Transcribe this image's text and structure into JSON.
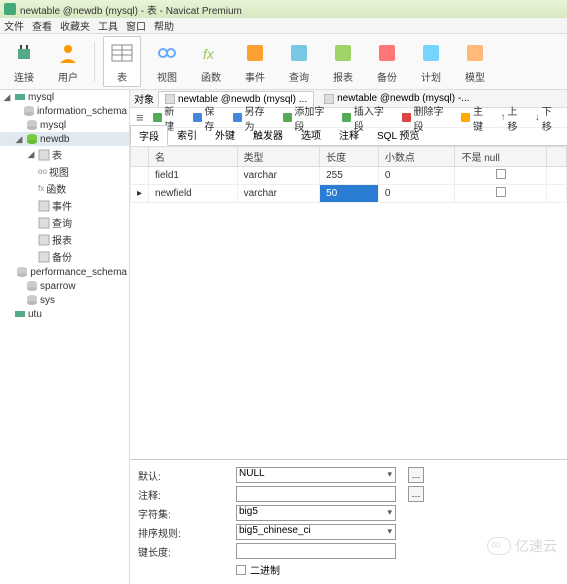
{
  "titlebar": {
    "text": "newtable @newdb (mysql) - 表 - Navicat Premium"
  },
  "menubar": {
    "items": [
      "文件",
      "查看",
      "收藏夹",
      "工具",
      "窗口",
      "帮助"
    ]
  },
  "ribbon": {
    "items": [
      {
        "label": "连接",
        "icon": "plug"
      },
      {
        "label": "用户",
        "icon": "user"
      },
      {
        "label": "表",
        "icon": "table",
        "active": true
      },
      {
        "label": "视图",
        "icon": "view"
      },
      {
        "label": "函数",
        "icon": "fx"
      },
      {
        "label": "事件",
        "icon": "clock"
      },
      {
        "label": "查询",
        "icon": "search"
      },
      {
        "label": "报表",
        "icon": "report"
      },
      {
        "label": "备份",
        "icon": "backup"
      },
      {
        "label": "计划",
        "icon": "schedule"
      },
      {
        "label": "模型",
        "icon": "model"
      }
    ]
  },
  "sidebar": {
    "items": [
      {
        "label": "mysql",
        "icon": "db-conn",
        "depth": 0,
        "expanded": true
      },
      {
        "label": "information_schema",
        "icon": "db",
        "depth": 1
      },
      {
        "label": "mysql",
        "icon": "db",
        "depth": 1
      },
      {
        "label": "newdb",
        "icon": "db-open",
        "depth": 1,
        "expanded": true,
        "selected": true
      },
      {
        "label": "表",
        "icon": "table",
        "depth": 2,
        "expanded": true
      },
      {
        "label": "视图",
        "icon": "view",
        "depth": 2,
        "prefix": "oo"
      },
      {
        "label": "函数",
        "icon": "fx",
        "depth": 2,
        "prefix": "fx"
      },
      {
        "label": "事件",
        "icon": "clock",
        "depth": 2
      },
      {
        "label": "查询",
        "icon": "search",
        "depth": 2
      },
      {
        "label": "报表",
        "icon": "report",
        "depth": 2
      },
      {
        "label": "备份",
        "icon": "backup",
        "depth": 2
      },
      {
        "label": "performance_schema",
        "icon": "db",
        "depth": 1
      },
      {
        "label": "sparrow",
        "icon": "db",
        "depth": 1
      },
      {
        "label": "sys",
        "icon": "db",
        "depth": 1
      },
      {
        "label": "utu",
        "icon": "db-conn",
        "depth": 0
      }
    ]
  },
  "tabbar": {
    "obj_label": "对象",
    "tabs": [
      {
        "label": "newtable @newdb (mysql) ...",
        "active": true
      },
      {
        "label": "newtable @newdb (mysql) -..."
      }
    ]
  },
  "sub_toolbar": {
    "hamburger": "≡",
    "items": [
      {
        "label": "新建",
        "icon": "new"
      },
      {
        "label": "保存",
        "icon": "save"
      },
      {
        "label": "另存为",
        "icon": "saveas"
      },
      {
        "label": "添加字段",
        "icon": "addfield"
      },
      {
        "label": "插入字段",
        "icon": "insertfield"
      },
      {
        "label": "删除字段",
        "icon": "delfield"
      },
      {
        "label": "主键",
        "icon": "pk"
      },
      {
        "label": "上移",
        "icon": "up",
        "arrow": "↑"
      },
      {
        "label": "下移",
        "icon": "down",
        "arrow": "↓"
      }
    ]
  },
  "sub_tabs": {
    "items": [
      "字段",
      "索引",
      "外键",
      "触发器",
      "选项",
      "注释",
      "SQL 预览"
    ],
    "active": 0
  },
  "grid": {
    "headers": [
      "名",
      "类型",
      "长度",
      "小数点",
      "不是 null"
    ],
    "rows": [
      {
        "name": "field1",
        "type": "varchar",
        "length": "255",
        "decimals": "0",
        "notnull": false,
        "selected": false
      },
      {
        "name": "newfield",
        "type": "varchar",
        "length": "50",
        "decimals": "0",
        "notnull": false,
        "selected": true,
        "indicator": "▸"
      }
    ]
  },
  "props": {
    "rows": [
      {
        "label": "默认:",
        "type": "select",
        "value": "NULL",
        "extra_btn": true
      },
      {
        "label": "注释:",
        "type": "input",
        "value": "",
        "extra_btn": true
      },
      {
        "label": "字符集:",
        "type": "select",
        "value": "big5"
      },
      {
        "label": "排序规则:",
        "type": "select",
        "value": "big5_chinese_ci"
      },
      {
        "label": "键长度:",
        "type": "input",
        "value": ""
      },
      {
        "label": "",
        "type": "checkbox",
        "check_label": "二进制"
      }
    ]
  },
  "watermark": {
    "text": "亿速云"
  }
}
